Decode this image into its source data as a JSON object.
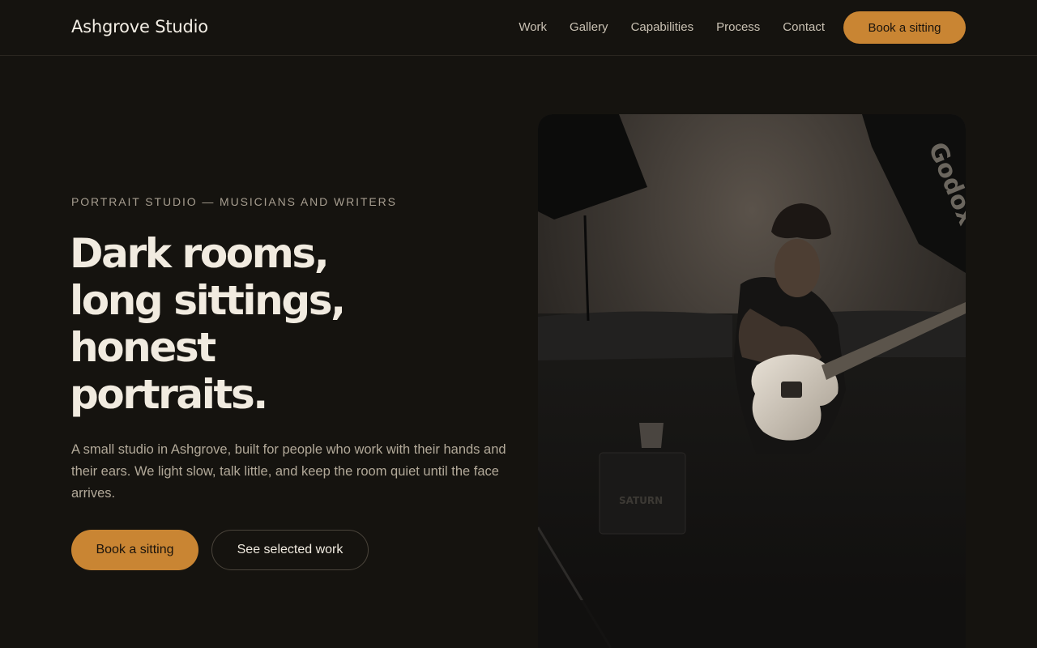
{
  "brand": "Ashgrove Studio",
  "nav": {
    "items": [
      "Work",
      "Gallery",
      "Capabilities",
      "Process",
      "Contact"
    ],
    "cta": "Book a sitting"
  },
  "hero": {
    "eyebrow": "PORTRAIT STUDIO — MUSICIANS AND WRITERS",
    "headline": [
      "Dark rooms,",
      "long sittings,",
      "honest",
      "portraits."
    ],
    "lede": "A small studio in Ashgrove, built for people who work with their hands and their ears. We light slow, talk little, and keep the room quiet until the face arrives.",
    "primary_cta": "Book a sitting",
    "secondary_cta": "See selected work"
  },
  "photo": {
    "softbox_brand": "Godox",
    "amp_label": "SATURN"
  },
  "colors": {
    "background": "#15130f",
    "accent": "#c98533",
    "text": "#f1ebe0",
    "muted": "#b2a999"
  }
}
